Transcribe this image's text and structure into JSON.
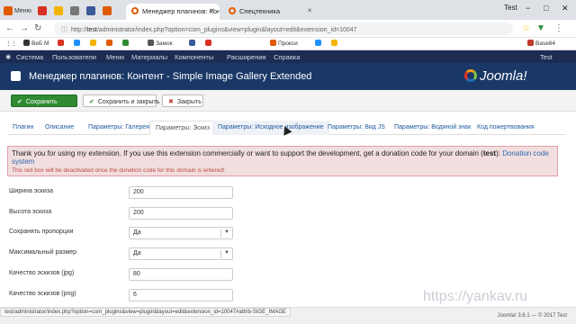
{
  "browser": {
    "mini_tabs": [
      {
        "label": "Меню",
        "color": "#e05a00"
      },
      {
        "label": "",
        "color": "#d93025"
      },
      {
        "label": "",
        "color": "#f4b400"
      },
      {
        "label": "",
        "color": "#777777"
      },
      {
        "label": "",
        "color": "#3b5998"
      },
      {
        "label": "",
        "color": "#e05a00"
      }
    ],
    "tabs": [
      {
        "label": "Менеджер плагинов: Кон"
      },
      {
        "label": "Спецтехника"
      }
    ],
    "url_prefix": "http://",
    "url_host": "test",
    "url_path": "/administrator/index.php?option=com_plugins&view=plugin&layout=edit&extension_id=10047",
    "window_controls": [
      "−",
      "□",
      "✕"
    ],
    "user_label": "Test",
    "bookmarks": [
      {
        "label": "ВеБ М",
        "color": "#333333"
      },
      {
        "label": "",
        "color": "#d93025"
      },
      {
        "label": "",
        "color": "#1e90ff"
      },
      {
        "label": "",
        "color": "#f4b400"
      },
      {
        "label": "",
        "color": "#e05a00"
      },
      {
        "label": "",
        "color": "#2f8a32"
      },
      {
        "label": "Замок",
        "color": "#555555"
      },
      {
        "label": "",
        "color": "#3b5998"
      },
      {
        "label": "",
        "color": "#d93025"
      },
      {
        "label": "Прокси",
        "color": "#e05a00"
      },
      {
        "label": "",
        "color": "#1e90ff"
      },
      {
        "label": "",
        "color": "#f4b400"
      },
      {
        "label": "Base64",
        "color": "#c0392b"
      }
    ]
  },
  "joomla_menu": [
    "Система",
    "Пользователи",
    "Меню",
    "Материалы",
    "Компоненты",
    "Расширения",
    "Справка"
  ],
  "joomla_user": "Test",
  "page_title": "Менеджер плагинов: Контент - Simple Image Gallery Extended",
  "logo_text": "Joomla!",
  "toolbar": {
    "save": "Сохранить",
    "save_close": "Сохранить и закрыть",
    "close": "Закрыть"
  },
  "tabs": [
    {
      "label": "Плагин"
    },
    {
      "label": "Описание"
    },
    {
      "label": "Параметры: Галерея"
    },
    {
      "label": "Параметры: Эскиз"
    },
    {
      "label": "Параметры: Исходное изображение"
    },
    {
      "label": "Параметры: Вид JS"
    },
    {
      "label": "Параметры: Водяной знак"
    },
    {
      "label": "Код пожертвования"
    }
  ],
  "active_tab": "Параметры: Эскиз",
  "notice": {
    "line1_before": "Thank you for using my extension. If you use this extension commercially or want to support the development, get a donation code for your domain (",
    "line1_domain": "test",
    "line1_after": "): ",
    "link": "Donation code system",
    "line2": "This red box will be deactivated once the donation code for this domain is entered!"
  },
  "fields": [
    {
      "label": "Ширина эскиза",
      "value": "200",
      "type": "text"
    },
    {
      "label": "Высота эскиза",
      "value": "200",
      "type": "text"
    },
    {
      "label": "Сохранять пропорции",
      "value": "Да",
      "type": "select"
    },
    {
      "label": "Максимальный размер",
      "value": "Да",
      "type": "select"
    },
    {
      "label": "Качество эскизов (jpg)",
      "value": "80",
      "type": "text"
    },
    {
      "label": "Качество эскизов (png)",
      "value": "6",
      "type": "text"
    }
  ],
  "status_url": "test/administrator/index.php?option=com_plugins&view=plugin&layout=edit&extension_id=10047#attrib-SIGE_IMAGE",
  "footer": "Joomla! 3.6.1 — © 2017 Test",
  "watermark": "https://yankav.ru"
}
